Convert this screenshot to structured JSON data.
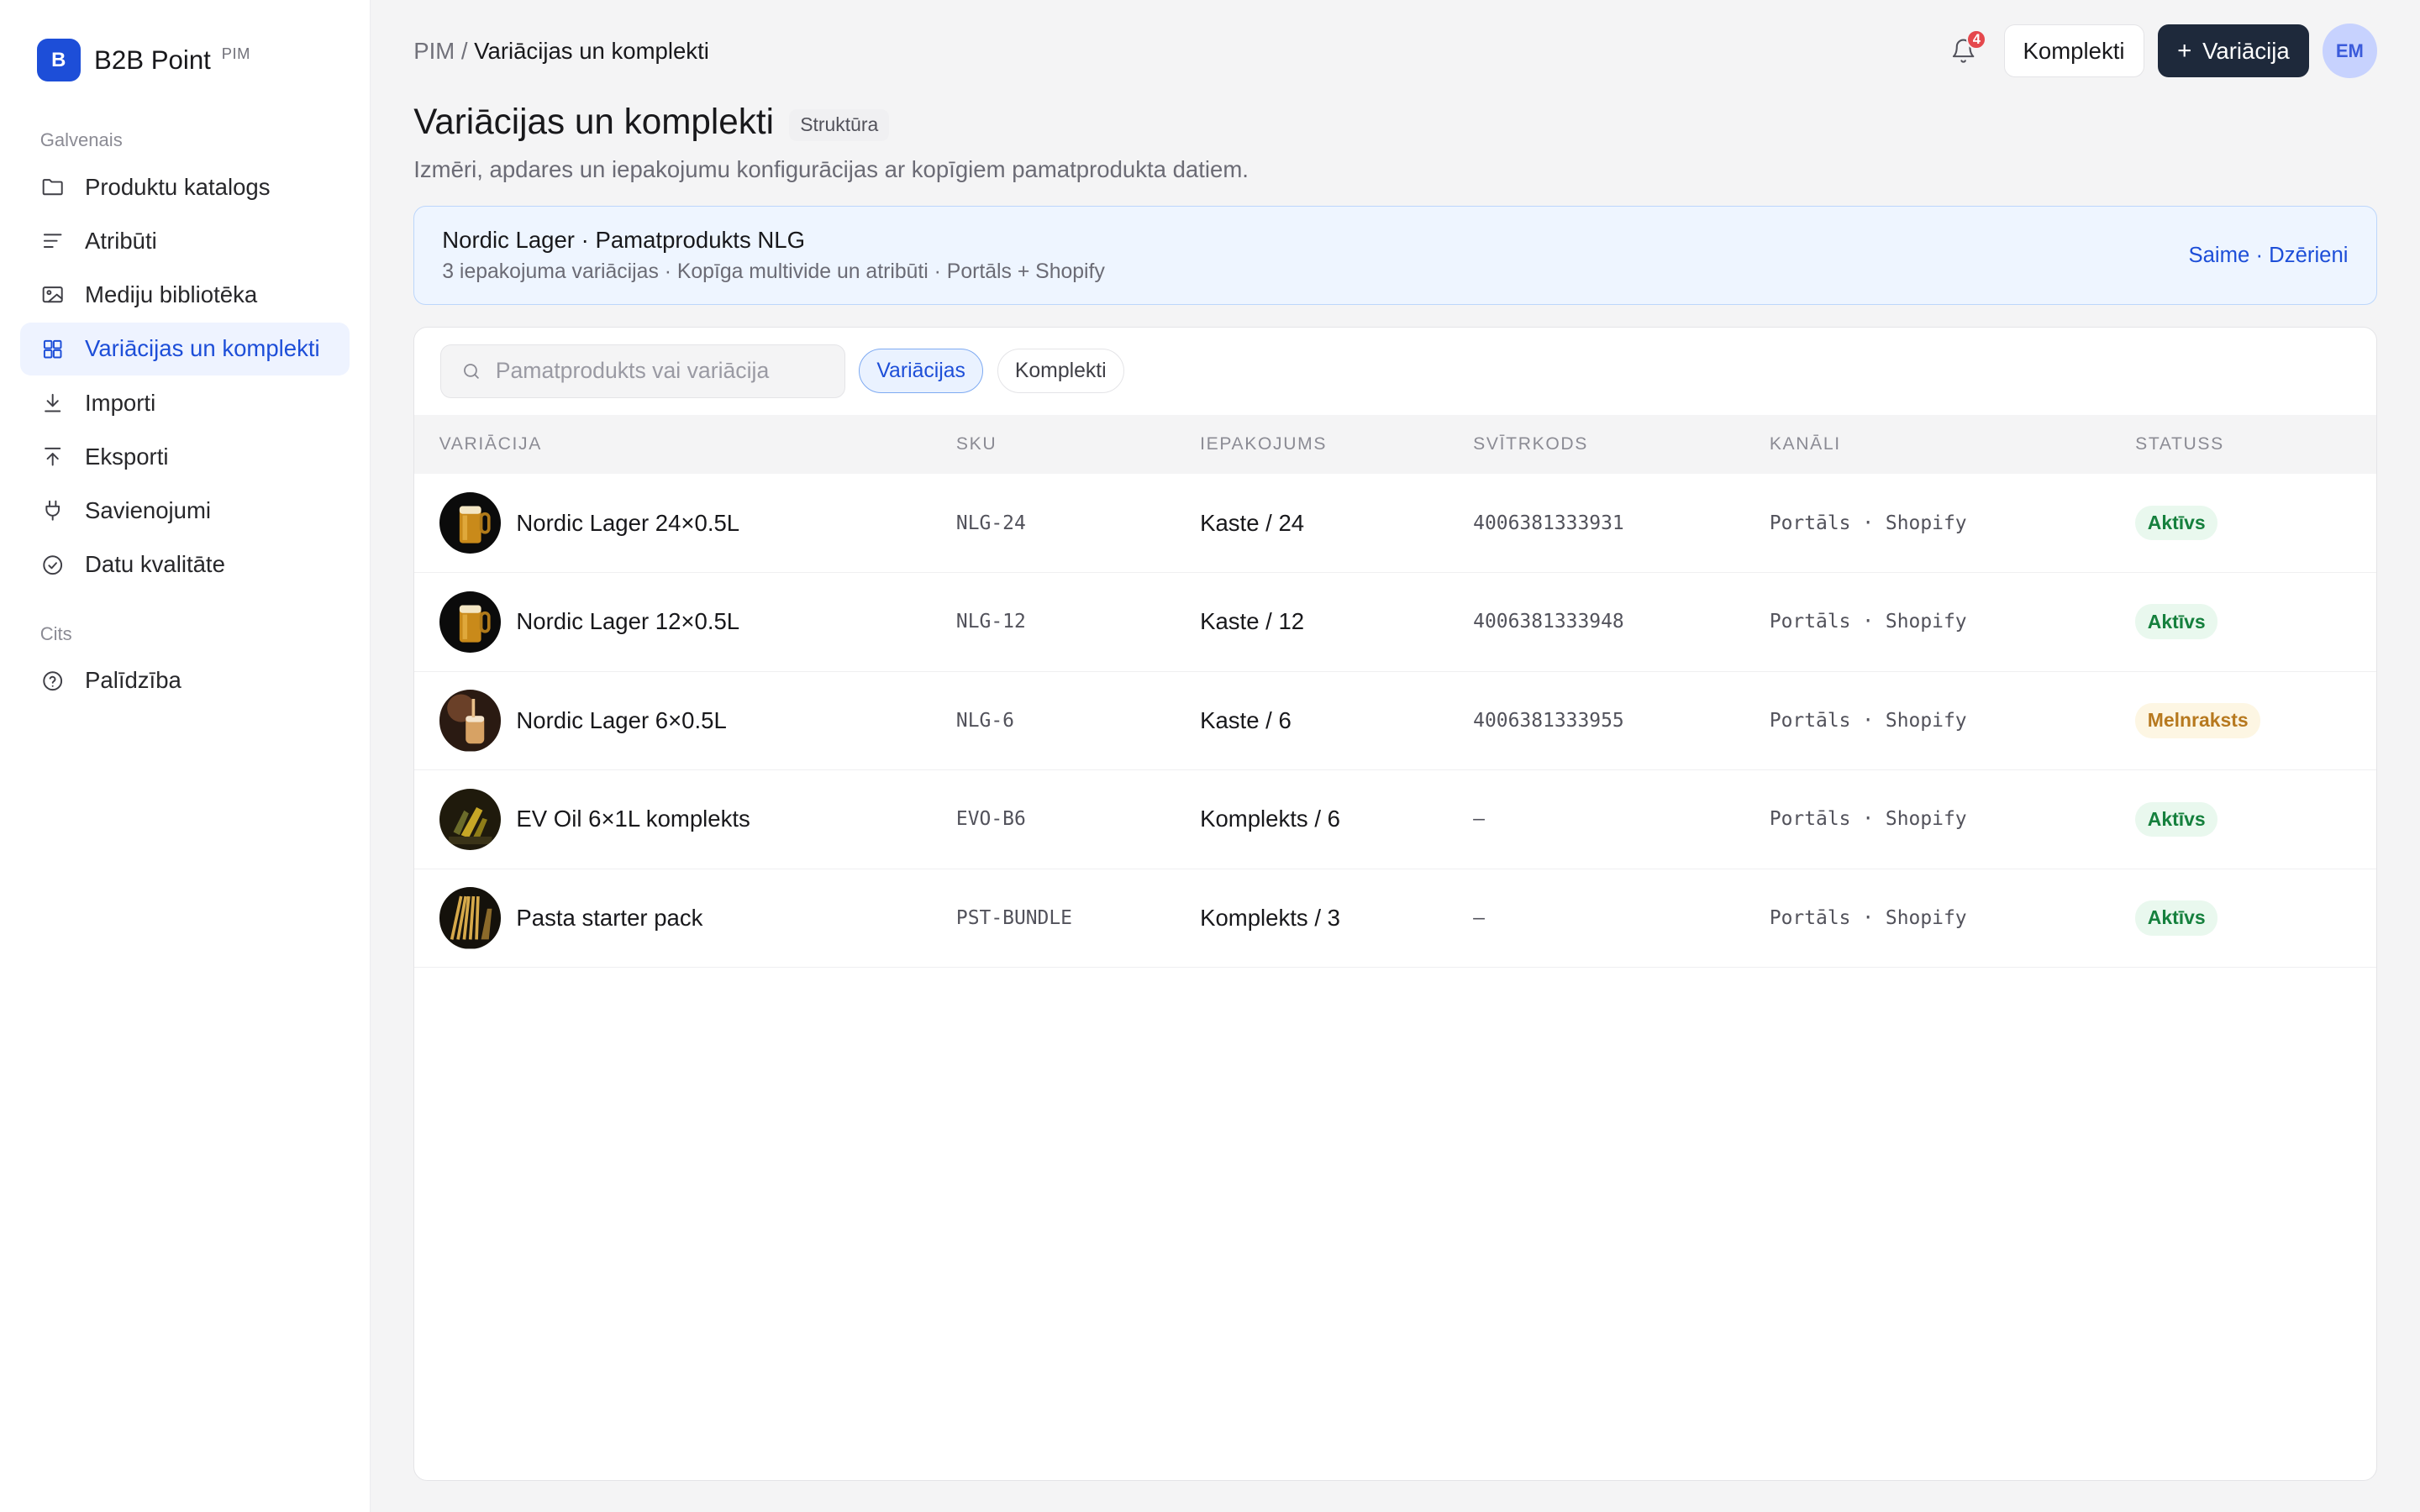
{
  "brand": {
    "logo_letter": "B",
    "name": "B2B Point",
    "tag": "PIM"
  },
  "sidebar": {
    "section_main": "Galvenais",
    "items": [
      {
        "label": "Produktu katalogs",
        "icon": "folder-icon"
      },
      {
        "label": "Atribūti",
        "icon": "list-icon"
      },
      {
        "label": "Mediju bibliotēka",
        "icon": "image-icon"
      },
      {
        "label": "Variācijas un komplekti",
        "icon": "grid-icon",
        "active": true
      },
      {
        "label": "Importi",
        "icon": "download-icon"
      },
      {
        "label": "Eksporti",
        "icon": "upload-icon"
      },
      {
        "label": "Savienojumi",
        "icon": "plug-icon"
      },
      {
        "label": "Datu kvalitāte",
        "icon": "check-circle-icon"
      }
    ],
    "section_other": "Cits",
    "other_items": [
      {
        "label": "Palīdzība",
        "icon": "help-circle-icon"
      }
    ]
  },
  "header": {
    "breadcrumb_root": "PIM",
    "breadcrumb_sep": "/",
    "breadcrumb_current": "Variācijas un komplekti",
    "notifications_count": "4",
    "bundles_button": "Komplekti",
    "add_button": "Variācija",
    "add_button_icon": "+",
    "avatar_initials": "EM"
  },
  "page": {
    "title": "Variācijas un komplekti",
    "tag": "Struktūra",
    "subtitle": "Izmēri, apdares un iepakojumu konfigurācijas ar kopīgiem pamatprodukta datiem."
  },
  "banner": {
    "title": "Nordic Lager · Pamatprodukts NLG",
    "subtitle": "3 iepakojuma variācijas · Kopīga multivide un atribūti · Portāls + Shopify",
    "link": "Saime · Dzērieni"
  },
  "filters": {
    "search_placeholder": "Pamatprodukts vai variācija",
    "chip_variations": "Variācijas",
    "chip_bundles": "Komplekti"
  },
  "table": {
    "columns": {
      "variation": "Variācija",
      "sku": "SKU",
      "packaging": "Iepakojums",
      "barcode": "Svītrkods",
      "channels": "Kanāli",
      "status": "Statuss"
    },
    "rows": [
      {
        "name": "Nordic Lager 24×0.5L",
        "sku": "NLG-24",
        "packaging": "Kaste / 24",
        "barcode": "4006381333931",
        "channels": "Portāls · Shopify",
        "status": "Aktīvs",
        "status_type": "active",
        "thumb": "beer-glass"
      },
      {
        "name": "Nordic Lager 12×0.5L",
        "sku": "NLG-12",
        "packaging": "Kaste / 12",
        "barcode": "4006381333948",
        "channels": "Portāls · Shopify",
        "status": "Aktīvs",
        "status_type": "active",
        "thumb": "beer-glass"
      },
      {
        "name": "Nordic Lager 6×0.5L",
        "sku": "NLG-6",
        "packaging": "Kaste / 6",
        "barcode": "4006381333955",
        "channels": "Portāls · Shopify",
        "status": "Melnraksts",
        "status_type": "draft",
        "thumb": "beer-pour"
      },
      {
        "name": "EV Oil 6×1L komplekts",
        "sku": "EVO-B6",
        "packaging": "Komplekts / 6",
        "barcode": "–",
        "channels": "Portāls · Shopify",
        "status": "Aktīvs",
        "status_type": "active",
        "thumb": "oil-bottle"
      },
      {
        "name": "Pasta starter pack",
        "sku": "PST-BUNDLE",
        "packaging": "Komplekts / 3",
        "barcode": "–",
        "channels": "Portāls · Shopify",
        "status": "Aktīvs",
        "status_type": "active",
        "thumb": "pasta"
      }
    ]
  },
  "colors": {
    "accent": "#1d4ed8",
    "primary_button": "#1e293b",
    "status_active": "#15803d",
    "status_draft": "#b7791f",
    "notification": "#e5484d"
  }
}
